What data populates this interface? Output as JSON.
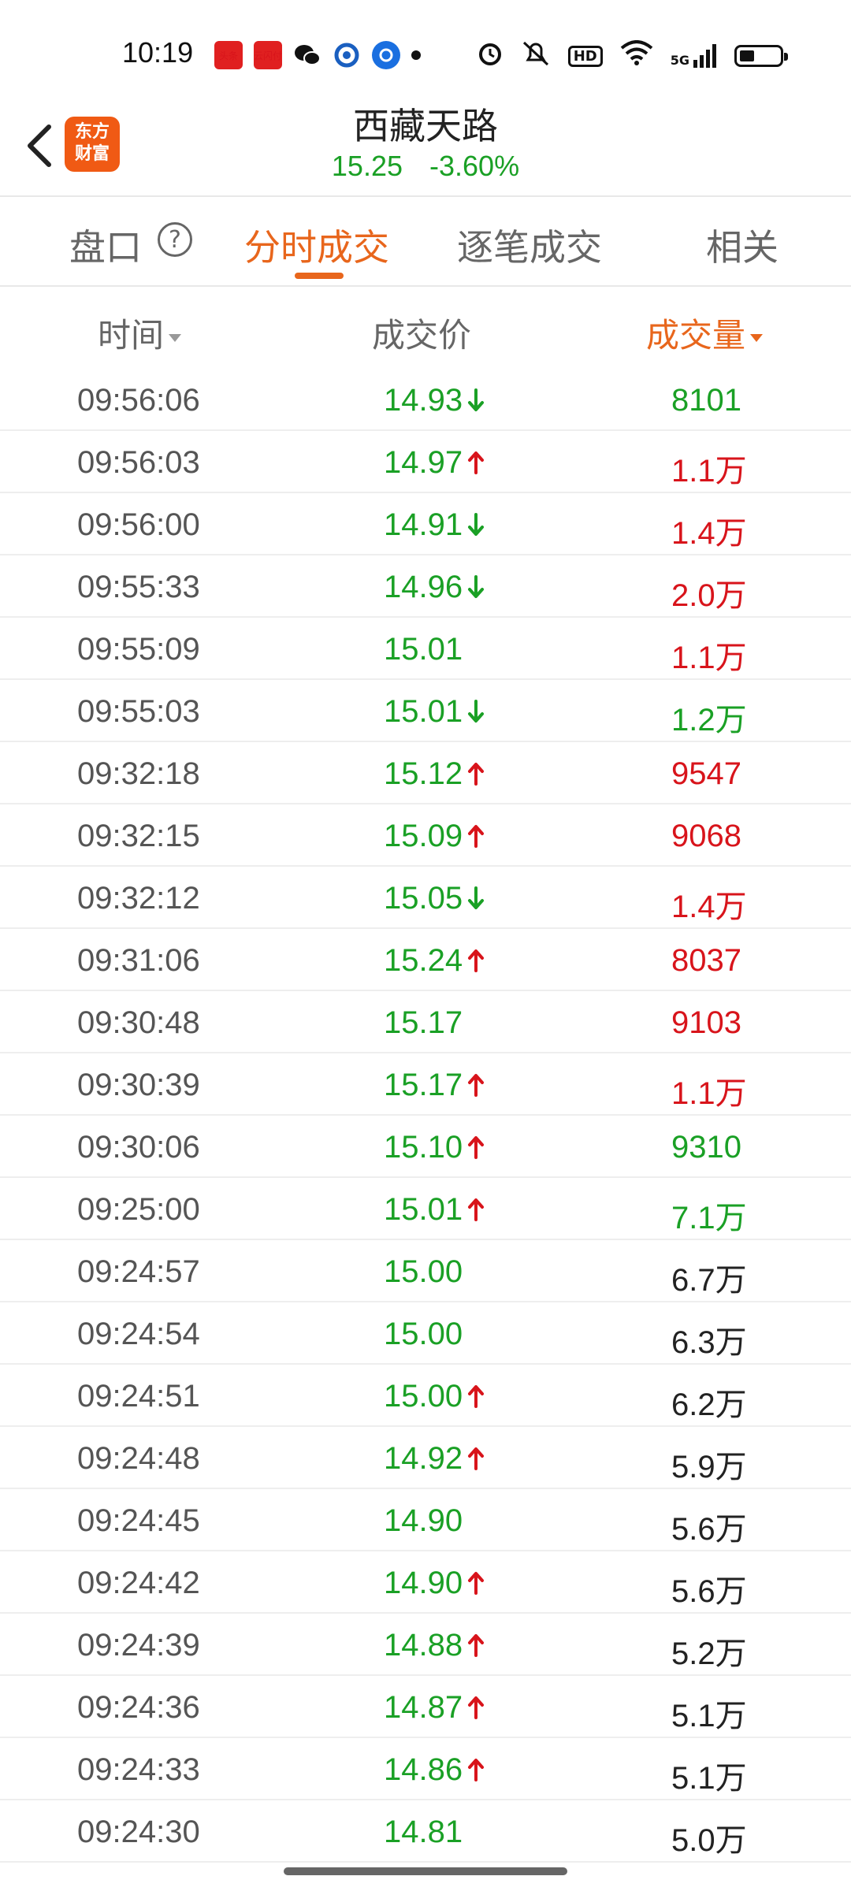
{
  "status_bar": {
    "time": "10:19",
    "notif_icons": [
      "toutiao-icon",
      "yunshanfu-icon",
      "wechat-icon",
      "app-icon",
      "app-icon-2"
    ],
    "notif_labels": [
      "头条",
      "云闪付"
    ],
    "network": "5G",
    "hd": "HD"
  },
  "header": {
    "stock_name": "西藏天路",
    "price": "15.25",
    "change": "-3.60%",
    "logo_text_1": "东方",
    "logo_text_2": "财富"
  },
  "tabs": [
    {
      "label": "盘口",
      "active": false
    },
    {
      "label": "分时成交",
      "active": true
    },
    {
      "label": "逐笔成交",
      "active": false
    },
    {
      "label": "相关",
      "active": false
    }
  ],
  "columns": {
    "time": "时间",
    "price": "成交价",
    "volume": "成交量"
  },
  "colors": {
    "accent": "#e8661c",
    "up": "#d8141b",
    "down": "#1aa025",
    "neutral": "#222222"
  },
  "trades": [
    {
      "time": "09:56:06",
      "price": "14.93",
      "dir": "down",
      "volume": "8101",
      "vol_color": "green"
    },
    {
      "time": "09:56:03",
      "price": "14.97",
      "dir": "up",
      "volume": "1.1万",
      "vol_color": "red"
    },
    {
      "time": "09:56:00",
      "price": "14.91",
      "dir": "down",
      "volume": "1.4万",
      "vol_color": "red"
    },
    {
      "time": "09:55:33",
      "price": "14.96",
      "dir": "down",
      "volume": "2.0万",
      "vol_color": "red"
    },
    {
      "time": "09:55:09",
      "price": "15.01",
      "dir": "none",
      "volume": "1.1万",
      "vol_color": "red"
    },
    {
      "time": "09:55:03",
      "price": "15.01",
      "dir": "down",
      "volume": "1.2万",
      "vol_color": "green"
    },
    {
      "time": "09:32:18",
      "price": "15.12",
      "dir": "up",
      "volume": "9547",
      "vol_color": "red"
    },
    {
      "time": "09:32:15",
      "price": "15.09",
      "dir": "up",
      "volume": "9068",
      "vol_color": "red"
    },
    {
      "time": "09:32:12",
      "price": "15.05",
      "dir": "down",
      "volume": "1.4万",
      "vol_color": "red"
    },
    {
      "time": "09:31:06",
      "price": "15.24",
      "dir": "up",
      "volume": "8037",
      "vol_color": "red"
    },
    {
      "time": "09:30:48",
      "price": "15.17",
      "dir": "none",
      "volume": "9103",
      "vol_color": "red"
    },
    {
      "time": "09:30:39",
      "price": "15.17",
      "dir": "up",
      "volume": "1.1万",
      "vol_color": "red"
    },
    {
      "time": "09:30:06",
      "price": "15.10",
      "dir": "up",
      "volume": "9310",
      "vol_color": "green"
    },
    {
      "time": "09:25:00",
      "price": "15.01",
      "dir": "up",
      "volume": "7.1万",
      "vol_color": "green"
    },
    {
      "time": "09:24:57",
      "price": "15.00",
      "dir": "none",
      "volume": "6.7万",
      "vol_color": "black"
    },
    {
      "time": "09:24:54",
      "price": "15.00",
      "dir": "none",
      "volume": "6.3万",
      "vol_color": "black"
    },
    {
      "time": "09:24:51",
      "price": "15.00",
      "dir": "up",
      "volume": "6.2万",
      "vol_color": "black"
    },
    {
      "time": "09:24:48",
      "price": "14.92",
      "dir": "up",
      "volume": "5.9万",
      "vol_color": "black"
    },
    {
      "time": "09:24:45",
      "price": "14.90",
      "dir": "none",
      "volume": "5.6万",
      "vol_color": "black"
    },
    {
      "time": "09:24:42",
      "price": "14.90",
      "dir": "up",
      "volume": "5.6万",
      "vol_color": "black"
    },
    {
      "time": "09:24:39",
      "price": "14.88",
      "dir": "up",
      "volume": "5.2万",
      "vol_color": "black"
    },
    {
      "time": "09:24:36",
      "price": "14.87",
      "dir": "up",
      "volume": "5.1万",
      "vol_color": "black"
    },
    {
      "time": "09:24:33",
      "price": "14.86",
      "dir": "up",
      "volume": "5.1万",
      "vol_color": "black"
    },
    {
      "time": "09:24:30",
      "price": "14.81",
      "dir": "none",
      "volume": "5.0万",
      "vol_color": "black"
    }
  ]
}
